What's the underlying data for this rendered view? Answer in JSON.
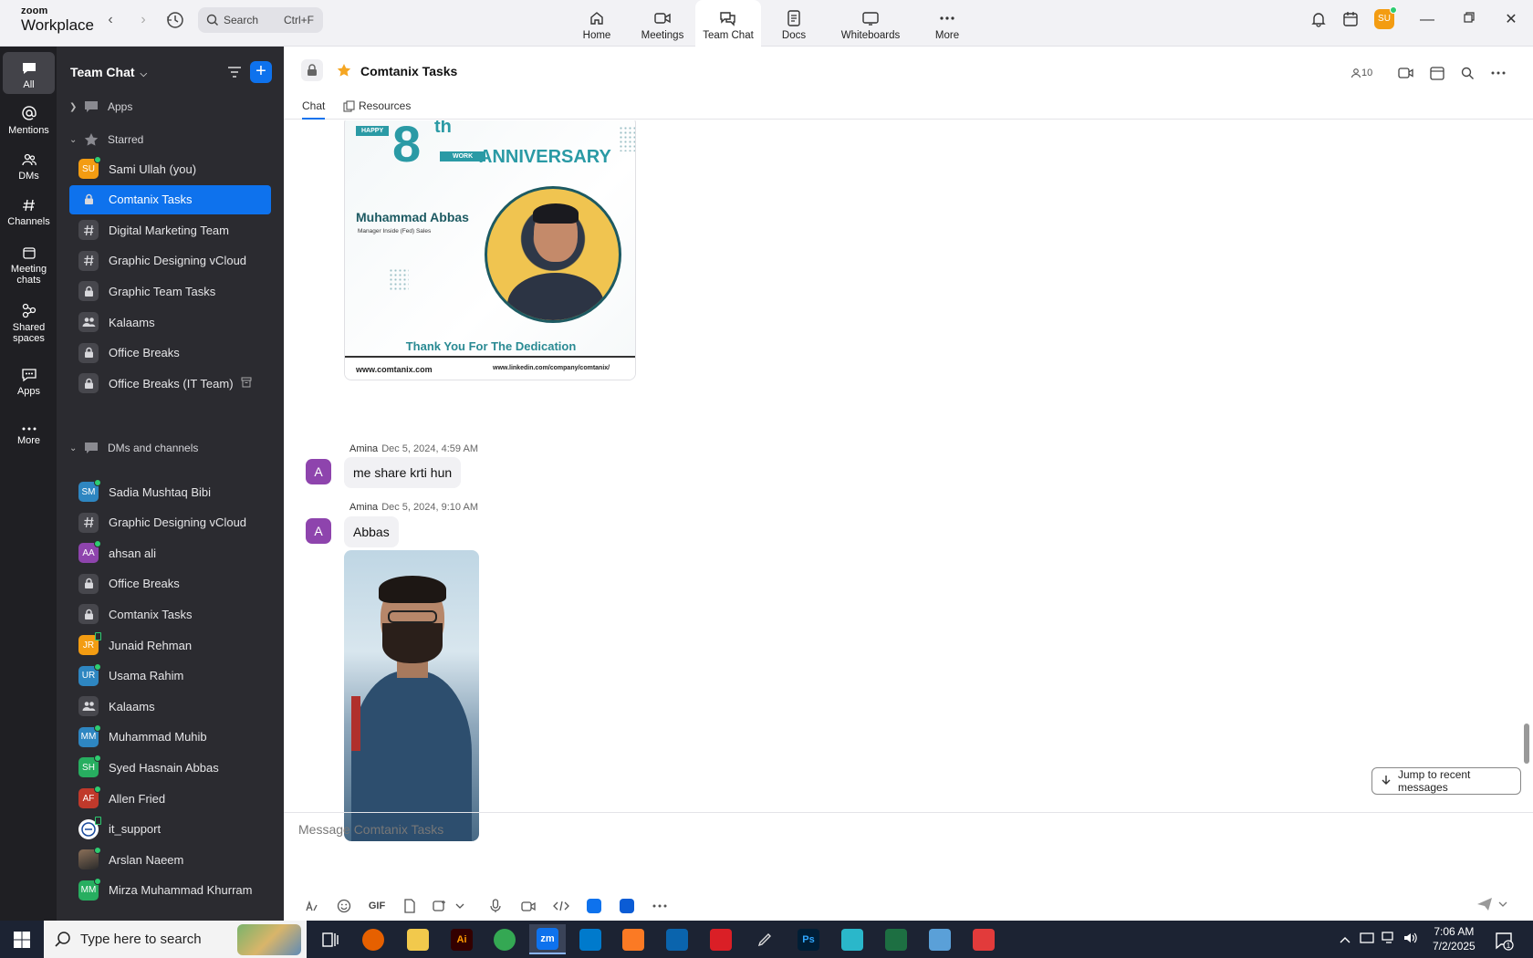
{
  "app": {
    "brand_small": "zoom",
    "brand_big": "Workplace",
    "search_placeholder": "Search",
    "search_shortcut": "Ctrl+F"
  },
  "topnav": [
    {
      "label": "Home",
      "icon": "home-icon"
    },
    {
      "label": "Meetings",
      "icon": "video-camera-icon"
    },
    {
      "label": "Team Chat",
      "icon": "chat-bubbles-icon",
      "active": true
    },
    {
      "label": "Docs",
      "icon": "document-icon"
    },
    {
      "label": "Whiteboards",
      "icon": "whiteboard-icon"
    },
    {
      "label": "More",
      "icon": "more-dots-icon"
    }
  ],
  "topright": {
    "avatar_initials": "SU"
  },
  "rail": [
    {
      "label": "All",
      "icon": "chat-icon",
      "active": true
    },
    {
      "label": "Mentions",
      "icon": "at-sign-icon"
    },
    {
      "label": "DMs",
      "icon": "people-icon"
    },
    {
      "label": "Channels",
      "icon": "hash-icon"
    },
    {
      "label": "Meeting chats",
      "icon": "calendar-icon"
    },
    {
      "label": "Shared spaces",
      "icon": "shared-spaces-icon"
    },
    {
      "label": "Apps",
      "icon": "apps-chat-icon"
    },
    {
      "label": "More",
      "icon": "more-dots-icon"
    }
  ],
  "sidebar": {
    "title": "Team Chat",
    "sections": {
      "apps": "Apps",
      "starred": "Starred",
      "dms": "DMs and channels"
    },
    "starred": [
      {
        "label": "Sami Ullah (you)",
        "type": "avatar",
        "initials": "SU",
        "color": "#f39c12",
        "presence": "online"
      },
      {
        "label": "Comtanix Tasks",
        "type": "lock",
        "active": true
      },
      {
        "label": "Digital Marketing Team",
        "type": "hash"
      },
      {
        "label": "Graphic Designing vCloud",
        "type": "hash"
      },
      {
        "label": "Graphic Team Tasks",
        "type": "lock"
      },
      {
        "label": "Kalaams",
        "type": "group"
      },
      {
        "label": "Office Breaks",
        "type": "lock"
      },
      {
        "label": "Office Breaks (IT Team)",
        "type": "lock",
        "extra": "archive"
      }
    ],
    "dms": [
      {
        "label": "Sadia Mushtaq Bibi",
        "type": "avatar",
        "initials": "SM",
        "color": "#2e86c1",
        "presence": "online"
      },
      {
        "label": "Graphic Designing vCloud",
        "type": "hash"
      },
      {
        "label": "ahsan ali",
        "type": "avatar",
        "initials": "AA",
        "color": "#8e44ad",
        "presence": "online"
      },
      {
        "label": "Office Breaks",
        "type": "lock"
      },
      {
        "label": "Comtanix Tasks",
        "type": "lock"
      },
      {
        "label": "Junaid Rehman",
        "type": "avatar",
        "initials": "JR",
        "color": "#f39c12",
        "presence": "mobile"
      },
      {
        "label": "Usama Rahim",
        "type": "avatar",
        "initials": "UR",
        "color": "#2e86c1",
        "presence": "online"
      },
      {
        "label": "Kalaams",
        "type": "group"
      },
      {
        "label": "Muhammad Muhib",
        "type": "avatar",
        "initials": "MM",
        "color": "#2e86c1",
        "presence": "online"
      },
      {
        "label": "Syed Hasnain Abbas",
        "type": "avatar",
        "initials": "SH",
        "color": "#27ae60",
        "presence": "online"
      },
      {
        "label": "Allen Fried",
        "type": "avatar",
        "initials": "AF",
        "color": "#c0392b",
        "presence": "online"
      },
      {
        "label": "it_support",
        "type": "logo",
        "presence": "mobile"
      },
      {
        "label": "Arslan Naeem",
        "type": "photo",
        "presence": "online"
      },
      {
        "label": "Mirza Muhammad Khurram",
        "type": "avatar",
        "initials": "MM",
        "color": "#27ae60",
        "presence": "online"
      }
    ]
  },
  "channel": {
    "name": "Comtanix Tasks",
    "tabs": [
      "Chat",
      "Resources"
    ],
    "member_count": "10"
  },
  "card": {
    "happy": "HAPPY",
    "number": "8",
    "suffix": "th",
    "work": "WORK",
    "anniversary": "ANNIVERSARY",
    "person": "Muhammad Abbas",
    "role": "Manager Inside (Fed) Sales",
    "thanks": "Thank You For The Dedication",
    "website": "www.comtanix.com",
    "linkedin": "www.linkedin.com/company/comtanix/"
  },
  "messages": [
    {
      "sender": "Amina",
      "time": "Dec 5, 2024, 4:59 AM",
      "text": "me share krti hun",
      "avatar": "A"
    },
    {
      "sender": "Amina",
      "time": "Dec 5, 2024, 9:10 AM",
      "text": "Abbas",
      "avatar": "A"
    }
  ],
  "jump_label": "Jump to recent messages",
  "composer": {
    "placeholder": "Message Comtanix Tasks",
    "gif_label": "GIF"
  },
  "taskbar": {
    "search_placeholder": "Type here to search",
    "time": "7:06 AM",
    "date": "7/2/2025",
    "notification_count": "1",
    "apps": [
      {
        "name": "task-view",
        "label": ""
      },
      {
        "name": "firefox",
        "label": ""
      },
      {
        "name": "file-explorer",
        "label": ""
      },
      {
        "name": "illustrator",
        "label": "Ai"
      },
      {
        "name": "chrome",
        "label": ""
      },
      {
        "name": "zoom",
        "label": "zm"
      },
      {
        "name": "vscode",
        "label": ""
      },
      {
        "name": "xampp",
        "label": ""
      },
      {
        "name": "outlook",
        "label": ""
      },
      {
        "name": "creative-cloud",
        "label": ""
      },
      {
        "name": "pen-tool",
        "label": ""
      },
      {
        "name": "photoshop",
        "label": "Ps"
      },
      {
        "name": "app-diamond",
        "label": ""
      },
      {
        "name": "excel",
        "label": ""
      },
      {
        "name": "notepad",
        "label": ""
      },
      {
        "name": "snipping",
        "label": ""
      }
    ]
  }
}
